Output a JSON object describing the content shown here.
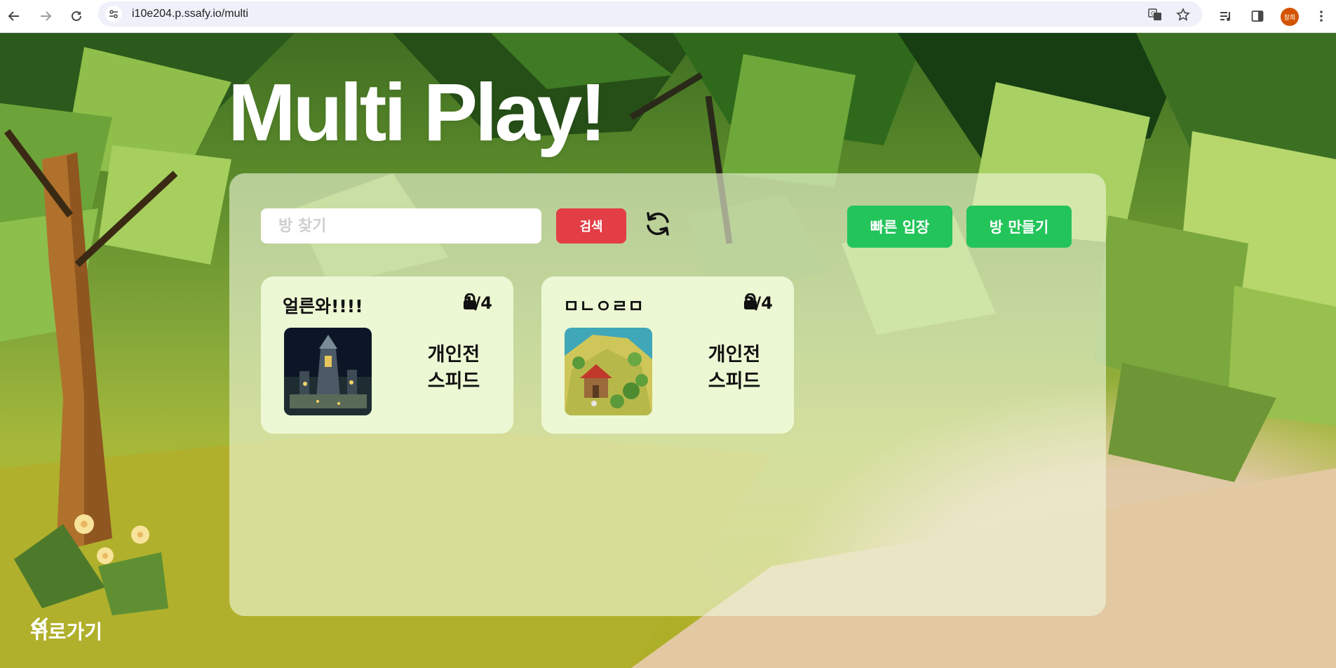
{
  "browser": {
    "url": "i10e204.p.ssafy.io/multi",
    "profile_initials": "창희"
  },
  "page": {
    "title": "Multi Play!",
    "search": {
      "placeholder": "방 찾기",
      "value": ""
    },
    "buttons": {
      "search": "검색",
      "quick_join": "빠른 입장",
      "create_room": "방 만들기"
    },
    "rooms": [
      {
        "name": "얼른와!!!!",
        "players": "1/4",
        "mode": "개인전",
        "type": "스피드",
        "locked": true,
        "thumbnail": "night-castle"
      },
      {
        "name": "ㅁㄴㅇㄹㅁ",
        "players": "3/4",
        "mode": "개인전",
        "type": "스피드",
        "locked": true,
        "thumbnail": "forest-village"
      }
    ],
    "back_label": "뒤로가기"
  },
  "colors": {
    "search_button": "#e33d45",
    "action_buttons": "#23c45a",
    "panel": "#eff7da",
    "card": "#ecf8d3"
  }
}
